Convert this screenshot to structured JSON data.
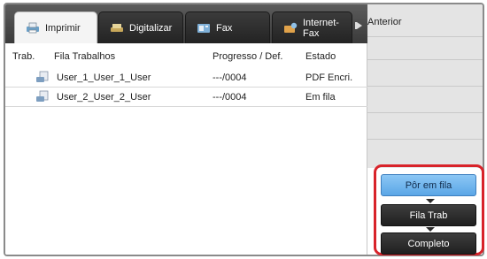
{
  "tabs": [
    {
      "label": "Imprimir",
      "icon": "printer-icon",
      "active": true
    },
    {
      "label": "Digitalizar",
      "icon": "scanner-icon",
      "active": false
    },
    {
      "label": "Fax",
      "icon": "fax-icon",
      "active": false
    },
    {
      "label": "Internet-Fax",
      "icon": "internet-fax-icon",
      "active": false
    }
  ],
  "list": {
    "headers": {
      "job": "Trab.",
      "queue": "Fila Trabalhos",
      "progress": "Progresso / Def.",
      "status": "Estado"
    },
    "rows": [
      {
        "name": "User_1_User_1_User",
        "progress": "---/0004",
        "status": "PDF Encri."
      },
      {
        "name": "User_2_User_2_User",
        "progress": "---/0004",
        "status": "Em fila"
      }
    ]
  },
  "side": {
    "previous_label": "Anterior"
  },
  "actions": {
    "queue_label": "Pôr em fila",
    "job_queue_label": "Fila Trab",
    "complete_label": "Completo"
  },
  "colors": {
    "active_button": "#5aa6e6",
    "highlight": "#d8232a"
  }
}
